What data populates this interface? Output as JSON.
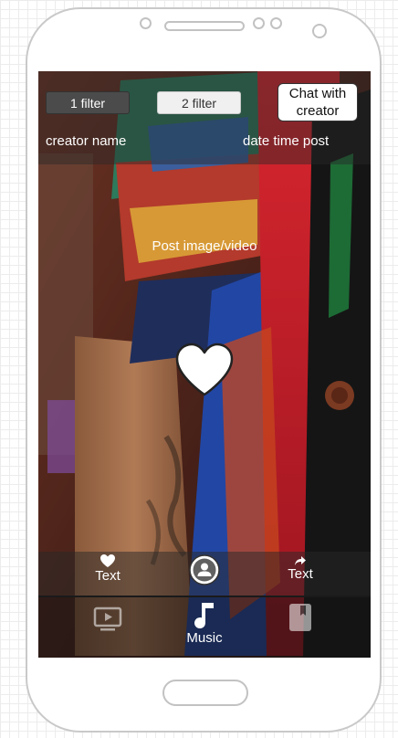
{
  "header": {
    "filter_1_label": "1 filter",
    "filter_2_label": "2 filter",
    "chat_button_label": "Chat with\ncreator",
    "creator_name": "creator name",
    "date_time": "date time post"
  },
  "post": {
    "media_caption": "Post image/video"
  },
  "actions": {
    "like_label": "Text",
    "share_label": "Text"
  },
  "nav": {
    "music_label": "Music"
  },
  "icons": {
    "like": "heart-icon",
    "share": "share-arrow-icon",
    "profile": "user-avatar-icon",
    "video": "video-play-icon",
    "music": "music-note-icon",
    "bookmark": "bookmark-icon"
  },
  "colors": {
    "filter_active_bg": "#4b4b4b",
    "filter_inactive_bg": "#f0f0f0",
    "overlay": "#282828",
    "text_on_overlay": "#ffffff"
  }
}
